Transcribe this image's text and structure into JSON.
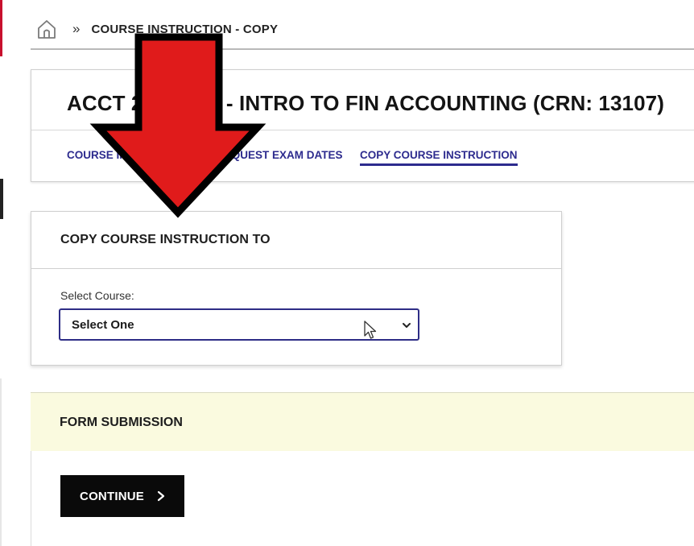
{
  "breadcrumb": {
    "home_icon": "home-icon",
    "separator": "»",
    "current": "COURSE INSTRUCTION - COPY"
  },
  "course": {
    "title": "ACCT 2101-002 - INTRO TO FIN ACCOUNTING (CRN: 13107)",
    "tabs": [
      {
        "label": "COURSE INSTRUCTION"
      },
      {
        "label": "REQUEST EXAM DATES"
      },
      {
        "label": "COPY COURSE INSTRUCTION",
        "active": true
      }
    ]
  },
  "copy_section": {
    "title": "COPY COURSE INSTRUCTION TO",
    "select_label": "Select Course:",
    "select_value": "Select One",
    "select_icon": "chevron-down-icon"
  },
  "form_submission": {
    "title": "FORM SUBMISSION",
    "continue_label": "CONTINUE",
    "continue_icon": "chevron-right-icon"
  },
  "overlay": {
    "arrow_icon": "arrow-down-icon",
    "arrow_color": "#e01b1b",
    "cursor_icon": "mouse-pointer-icon"
  },
  "colors": {
    "link": "#2d2b8e",
    "submission_band": "#fafadf",
    "button": "#0a0a0a"
  }
}
